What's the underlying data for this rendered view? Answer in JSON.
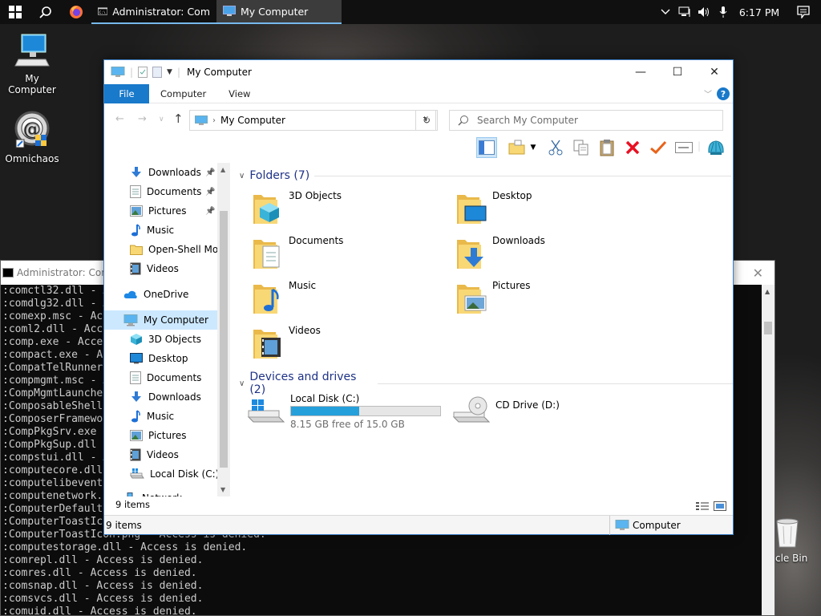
{
  "taskbar": {
    "apps": [
      {
        "label": "Administrator: Com"
      },
      {
        "label": "My Computer"
      }
    ],
    "clock": "6:17 PM"
  },
  "desktop": {
    "icons": [
      "My Computer",
      "Omnichaos",
      "cle Bin"
    ]
  },
  "console": {
    "title": "Administrator: Comr",
    "lines": [
      ":comctl32.dll - A",
      ":comdlg32.dll - A",
      ":comexp.msc - Ac",
      ":coml2.dll - Acc",
      ":comp.exe - Acces",
      ":compact.exe - Ac",
      ":CompatTelRunner",
      ":compmgmt.msc - A",
      ":CompMgmtLauncher",
      ":ComposableShell",
      ":ComposerFramewor",
      ":CompPkgSrv.exe",
      ":CompPkgSup.dll",
      ":compstui.dll - A",
      ":computecore.dll",
      ":computelibevent",
      ":computenetwork.d",
      ":ComputerDefault",
      ":ComputerToastIc",
      ":ComputerToastIcon.png - Access is denied.",
      ":computestorage.dll - Access is denied.",
      ":comrepl.dll - Access is denied.",
      ":comres.dll - Access is denied.",
      ":comsnap.dll - Access is denied.",
      ":comsvcs.dll - Access is denied.",
      ":comuid.dll - Access is denied."
    ]
  },
  "explorer": {
    "title": "My Computer",
    "ribbon_tabs": [
      "File",
      "Computer",
      "View"
    ],
    "address": "My Computer",
    "search_placeholder": "Search My Computer",
    "nav_items": [
      {
        "label": "Downloads",
        "icon": "downloads-icon",
        "pinned": true
      },
      {
        "label": "Documents",
        "icon": "documents-icon",
        "pinned": true
      },
      {
        "label": "Pictures",
        "icon": "pictures-icon",
        "pinned": true
      },
      {
        "label": "Music",
        "icon": "music-icon",
        "pinned": false
      },
      {
        "label": "Open-Shell Mod",
        "icon": "folder-icon",
        "pinned": false
      },
      {
        "label": "Videos",
        "icon": "videos-icon",
        "pinned": false
      },
      {
        "label": "OneDrive",
        "icon": "onedrive-icon",
        "pinned": false
      },
      {
        "label": "My Computer",
        "icon": "computer-icon",
        "pinned": false,
        "selected": true
      },
      {
        "label": "3D Objects",
        "icon": "3d-objects-icon",
        "pinned": false
      },
      {
        "label": "Desktop",
        "icon": "desktop-icon",
        "pinned": false
      },
      {
        "label": "Documents",
        "icon": "documents-icon",
        "pinned": false
      },
      {
        "label": "Downloads",
        "icon": "downloads-icon",
        "pinned": false
      },
      {
        "label": "Music",
        "icon": "music-icon",
        "pinned": false
      },
      {
        "label": "Pictures",
        "icon": "pictures-icon",
        "pinned": false
      },
      {
        "label": "Videos",
        "icon": "videos-icon",
        "pinned": false
      },
      {
        "label": "Local Disk (C:)",
        "icon": "drive-icon",
        "pinned": false
      },
      {
        "label": "Network",
        "icon": "network-icon",
        "pinned": false
      }
    ],
    "folders_header": "Folders (7)",
    "folders": [
      {
        "name": "3D Objects",
        "overlay": "3d-objects-icon"
      },
      {
        "name": "Desktop",
        "overlay": "desktop-icon"
      },
      {
        "name": "Documents",
        "overlay": "documents-icon"
      },
      {
        "name": "Downloads",
        "overlay": "downloads-icon"
      },
      {
        "name": "Music",
        "overlay": "music-icon"
      },
      {
        "name": "Pictures",
        "overlay": "pictures-icon"
      },
      {
        "name": "Videos",
        "overlay": "videos-icon"
      }
    ],
    "devices_header": "Devices and drives (2)",
    "drives": [
      {
        "name": "Local Disk (C:)",
        "free": "8.15 GB free of 15.0 GB",
        "used_fraction": 0.457
      },
      {
        "name": "CD Drive (D:)"
      }
    ],
    "item_count": "9 items",
    "status_items": "9 items",
    "status_location": "Computer"
  },
  "colors": {
    "accent": "#1979ca",
    "group_header": "#1e3287",
    "selection": "#cce8ff",
    "drive_bar": "#26a0da"
  }
}
